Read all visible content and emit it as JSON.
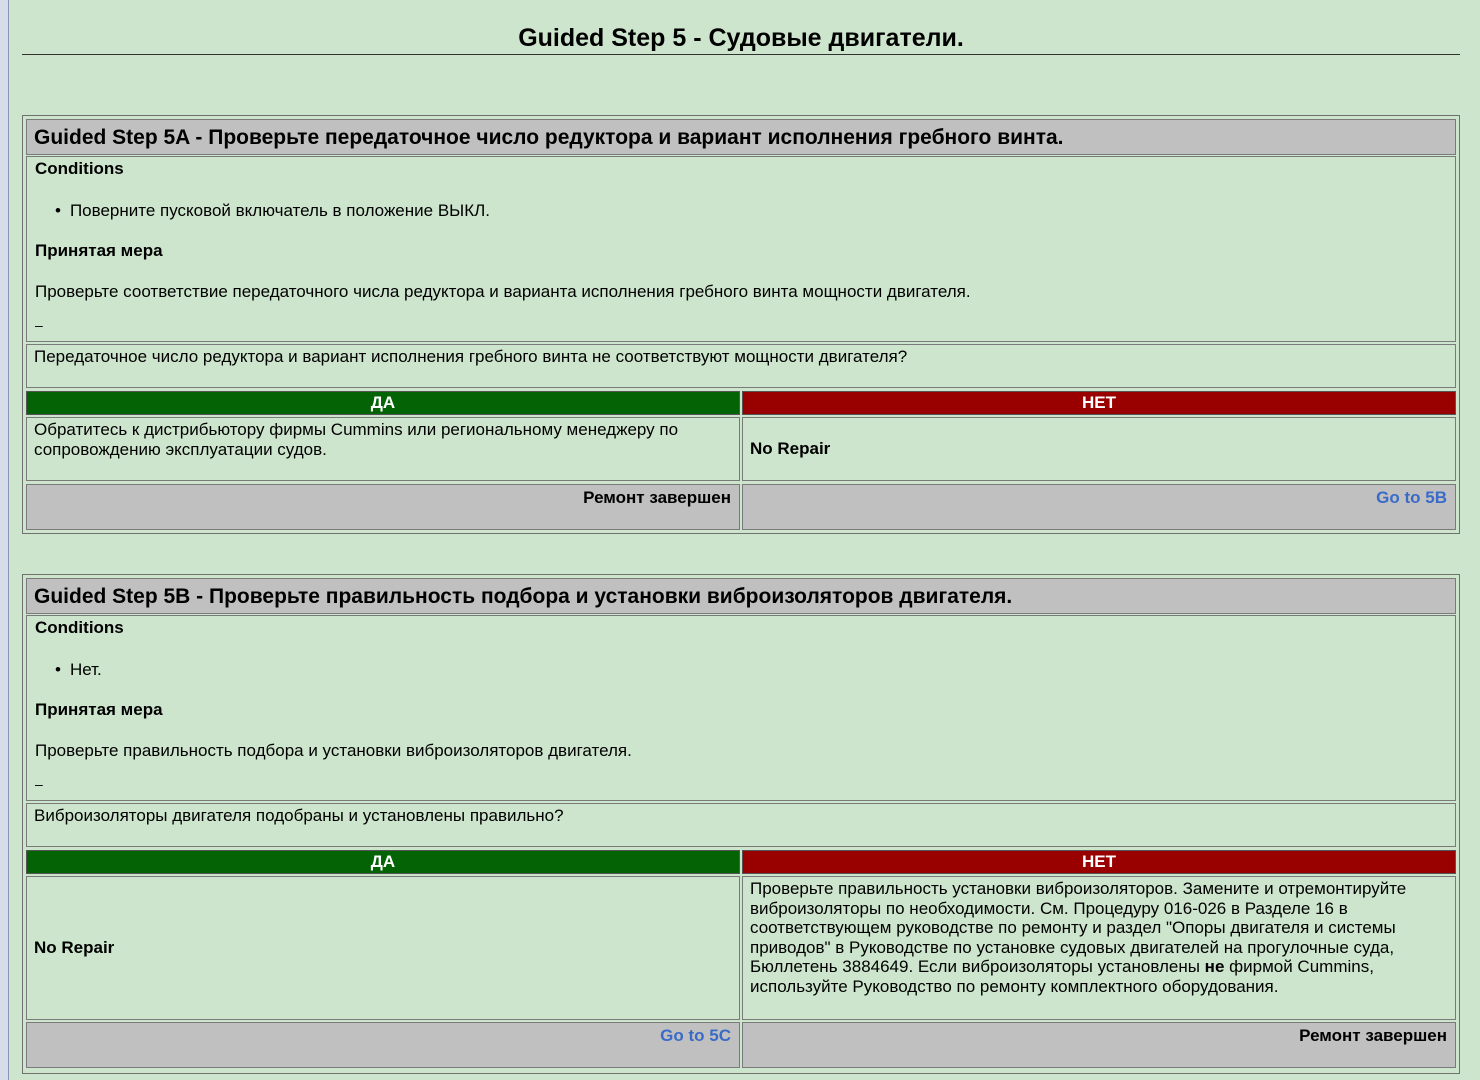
{
  "page": {
    "title": "Guided Step 5 - Судовые двигатели."
  },
  "steps": [
    {
      "title": "Guided Step 5A - Проверьте передаточное число редуктора и вариант исполнения гребного винта.",
      "conditions_label": "Conditions",
      "conditions": [
        "Поверните пусковой включатель в положение ВЫКЛ."
      ],
      "action_label": "Принятая мера",
      "action": "Проверьте соответствие передаточного числа редуктора и варианта исполнения гребного винта мощности двигателя.",
      "dash": "–",
      "question": "Передаточное число редуктора и вариант исполнения гребного винта не соответствуют мощности двигателя?",
      "yes_label": "ДА",
      "no_label": "НЕТ",
      "yes_text": "Обратитесь к дистрибьютору фирмы Cummins или региональному менеджеру по сопровождению эксплуатации судов.",
      "no_text": "No Repair",
      "yes_footer": "Ремонт завершен",
      "no_footer": "Go to 5B"
    },
    {
      "title": "Guided Step 5B - Проверьте правильность подбора и установки виброизоляторов двигателя.",
      "conditions_label": "Conditions",
      "conditions": [
        "Нет."
      ],
      "action_label": "Принятая мера",
      "action": "Проверьте правильность подбора и установки виброизоляторов двигателя.",
      "dash": "–",
      "question": "Виброизоляторы двигателя подобраны и установлены правильно?",
      "yes_label": "ДА",
      "no_label": "НЕТ",
      "yes_text": "No Repair",
      "no_text_part1": "Проверьте правильность установки виброизоляторов. Замените и отремонтируйте виброизоляторы по необходимости. См. Процедуру 016-026 в Разделе 16 в соответствующем руководстве по ремонту и раздел \"Опоры двигателя и системы приводов\" в Руководстве по установке судовых двигателей на прогулочные суда, Бюллетень 3884649. Если виброизоляторы установлены ",
      "no_text_bold": "не",
      "no_text_part2": " фирмой Cummins, используйте Руководство по ремонту комплектного оборудования.",
      "yes_footer": "Go to 5C",
      "no_footer": "Ремонт завершен"
    }
  ]
}
